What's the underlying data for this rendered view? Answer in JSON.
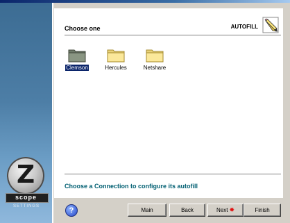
{
  "header": {
    "title": "Choose one",
    "mode": "AUTOFILL",
    "mode_icon": "pencil-icon"
  },
  "folders": [
    {
      "label": "Clemson",
      "selected": true
    },
    {
      "label": "Hercules",
      "selected": false
    },
    {
      "label": "Netshare",
      "selected": false
    }
  ],
  "status": {
    "text": "Choose a Connection to configure its autofill"
  },
  "logo": {
    "letter": "Z",
    "word": "scope",
    "caption": "SETTINGS"
  },
  "buttons": {
    "main": "Main",
    "back": "Back",
    "next": "Next",
    "finish": "Finish"
  },
  "colors": {
    "accent": "#005f72",
    "selection": "#0a246a",
    "sidebar": "#4d7ea6"
  }
}
